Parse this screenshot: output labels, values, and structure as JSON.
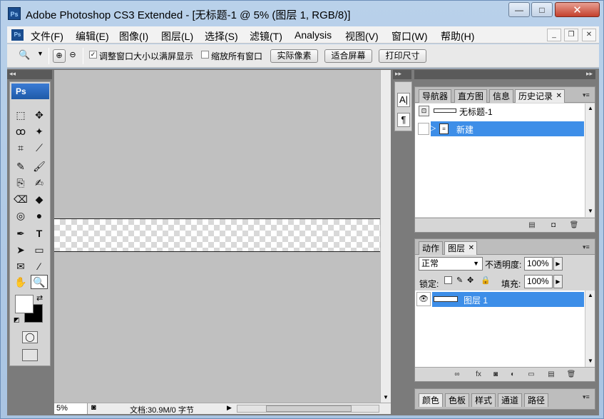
{
  "window": {
    "title": "Adobe Photoshop CS3 Extended - [无标题-1 @ 5% (图层 1, RGB/8)]",
    "app_icon_text": "Ps",
    "buttons": {
      "minimize": "—",
      "maximize": "□",
      "close": "✕"
    }
  },
  "menubar": {
    "icon_text": "Ps",
    "items": [
      {
        "label": "文件(F)"
      },
      {
        "label": "编辑(E)"
      },
      {
        "label": "图像(I)"
      },
      {
        "label": "图层(L)"
      },
      {
        "label": "选择(S)"
      },
      {
        "label": "滤镜(T)"
      },
      {
        "label": "Analysis"
      },
      {
        "label": "视图(V)"
      },
      {
        "label": "窗口(W)"
      },
      {
        "label": "帮助(H)"
      }
    ],
    "doc_controls": {
      "minimize": "_",
      "restore": "❐",
      "close": "✕"
    }
  },
  "optionsbar": {
    "tool_icon": "🔍",
    "resize_windows_checked": true,
    "resize_windows_label": "调整窗口大小以满屏显示",
    "zoom_all_checked": false,
    "zoom_all_label": "缩放所有窗口",
    "buttons": {
      "actual_pixels": "实际像素",
      "fit_screen": "适合屏幕",
      "print_size": "打印尺寸"
    }
  },
  "toolbox": {
    "logo": "Ps",
    "tools": [
      "⬚",
      "✥",
      "ꝏ",
      "✦",
      "⌗",
      "⟋",
      "✎",
      "🖌",
      "⎘",
      "✍",
      "⌫",
      "◆",
      "◎",
      "●",
      "✒",
      "T",
      "➤",
      "▭",
      "✉",
      "⁄",
      "✋",
      "🔍"
    ]
  },
  "status": {
    "zoom": "5%",
    "doc_info": "文档:30.9M/0 字节"
  },
  "dock": {
    "char_icon": "A|",
    "para_icon": "¶"
  },
  "history_panel": {
    "tabs": [
      "导航器",
      "直方图",
      "信息",
      "历史记录"
    ],
    "active_tab": "历史记录",
    "snapshot_label": "无标题-1",
    "states": [
      {
        "label": "新建",
        "selected": true
      }
    ]
  },
  "layers_panel": {
    "tabs": [
      "动作",
      "图层"
    ],
    "active_tab": "图层",
    "blend_mode": "正常",
    "opacity_label": "不透明度:",
    "opacity_value": "100%",
    "lock_label": "锁定:",
    "fill_label": "填充:",
    "fill_value": "100%",
    "layers": [
      {
        "name": "图层 1",
        "visible": true,
        "selected": true
      }
    ]
  },
  "color_panel": {
    "tabs": [
      "颜色",
      "色板",
      "样式",
      "通道",
      "路径"
    ]
  }
}
